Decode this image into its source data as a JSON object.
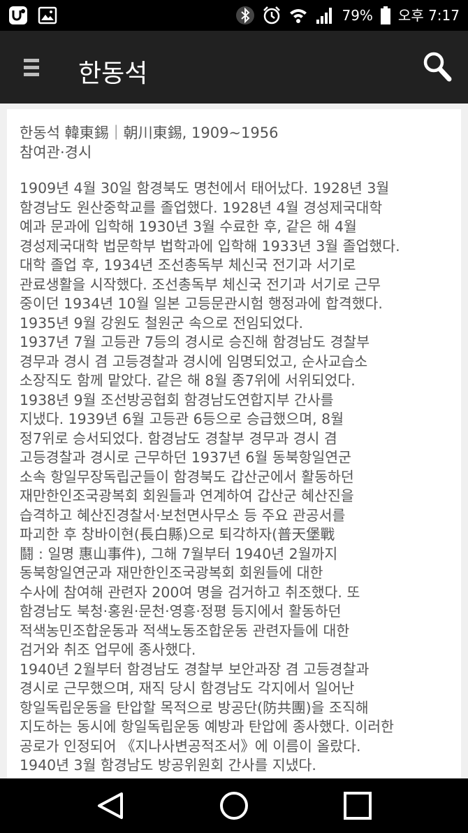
{
  "status_bar": {
    "battery_pct": "79%",
    "time": "오후 7:17",
    "icons": [
      "u-plus-icon",
      "gallery-icon",
      "bluetooth-icon",
      "alarm-icon",
      "wifi-icon",
      "signal-icon",
      "battery-icon"
    ]
  },
  "app_bar": {
    "title": "한동석",
    "icons": [
      "menu-icon",
      "search-icon"
    ]
  },
  "article": {
    "header_lines": [
      "한동석 韓東錫｜朝川東錫, 1909~1956",
      "참여관·경시"
    ],
    "body_lines": [
      "1909년 4월 30일 함경북도 명천에서 태어났다. 1928년 3월",
      "함경남도 원산중학교를 졸업했다. 1928년 4월 경성제국대학",
      "예과 문과에 입학해 1930년 3월 수료한 후, 같은 해 4월",
      "경성제국대학 법문학부 법학과에 입학해 1933년 3월 졸업했다.",
      "대학 졸업 후, 1934년 조선총독부 체신국 전기과 서기로",
      "관료생활을 시작했다. 조선총독부 체신국 전기과 서기로 근무",
      "중이던 1934년 10월 일본 고등문관시험 행정과에 합격했다.",
      "1935년 9월 강원도 철원군 속으로 전임되었다.",
      "1937년 7월 고등관 7등의 경시로 승진해 함경남도 경찰부",
      "경무과 경시 겸 고등경찰과 경시에 임명되었고, 순사교습소",
      "소장직도 함께 맡았다. 같은 해 8월 종7위에 서위되었다.",
      "1938년 9월 조선방공협회 함경남도연합지부 간사를",
      "지냈다. 1939년 6월 고등관 6등으로 승급했으며, 8월",
      "정7위로 승서되었다. 함경남도 경찰부 경무과 경시 겸",
      "고등경찰과 경시로 근무하던 1937년 6월 동북항일연군",
      "소속 항일무장독립군들이 함경북도 갑산군에서 활동하던",
      "재만한인조국광복회 회원들과 연계하여 갑산군 혜산진을",
      "습격하고 혜산진경찰서·보천면사무소 등 주요 관공서를",
      "파괴한 후 창바이현(長白縣)으로 퇴각하자(普天堡戰",
      "鬪 : 일명 惠山事件), 그해 7월부터 1940년 2월까지",
      "동북항일연군과 재만한인조국광복회 회원들에 대한",
      "수사에 참여해 관련자 200여 명을 검거하고 취조했다. 또",
      "함경남도 북청·홍원·문천·영흥·정평 등지에서 활동하던",
      "적색농민조합운동과 적색노동조합운동 관련자들에 대한",
      "검거와 취조 업무에 종사했다.",
      "1940년 2월부터 함경남도 경찰부 보안과장 겸 고등경찰과",
      "경시로 근무했으며, 재직 당시 함경남도 각지에서 일어난",
      "항일독립운동을 탄압할 목적으로 방공단(防共團)을 조직해",
      "지도하는 동시에 항일독립운동 예방과 탄압에 종사했다. 이러한",
      "공로가 인정되어 《지나사변공적조서》에 이름이 올랐다.",
      "1940년 3월 함경남도 방공위원회 간사를 지냈다."
    ]
  },
  "nav_bar": {
    "icons": [
      "back-icon",
      "home-icon",
      "recents-icon"
    ]
  }
}
